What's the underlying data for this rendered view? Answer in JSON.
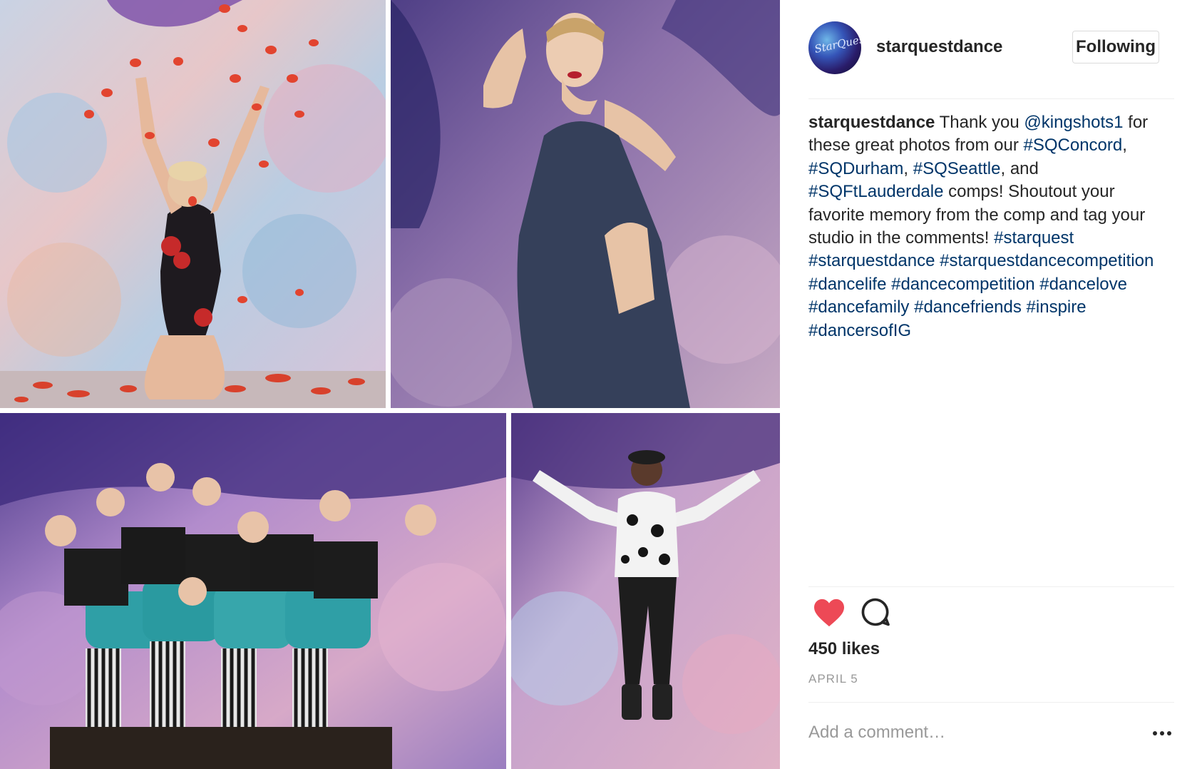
{
  "post": {
    "username": "starquestdance",
    "avatar_text": "StarQuest",
    "follow_label": "Following",
    "caption": {
      "username": "starquestdance",
      "text_thank": " Thank you ",
      "mention": "@kingshots1",
      "text_for": " for these great photos from our ",
      "tag_concord": "#SQConcord",
      "sep1": ", ",
      "tag_durham": "#SQDurham",
      "sep2": ", ",
      "tag_seattle": "#SQSeattle",
      "sep3": ", and ",
      "tag_ftl": "#SQFtLauderdale",
      "text_rest": " comps! Shoutout your favorite memory from the comp and tag your studio in the comments! ",
      "hashtags": [
        "#starquest",
        "#starquestdance",
        "#starquestdancecompetition",
        "#dancelife",
        "#dancecompetition",
        "#dancelove",
        "#dancefamily",
        "#dancefriends",
        "#inspire",
        "#dancersofIG"
      ]
    },
    "likes": "450 likes",
    "date": "APRIL 5",
    "comment_placeholder": "Add a comment…",
    "liked": true,
    "colors": {
      "heart": "#ed4956",
      "link": "#003569",
      "muted": "#999999",
      "text": "#262626",
      "border": "#dbdbdb"
    },
    "icons": [
      "heart-icon",
      "comment-icon",
      "more-options-icon"
    ]
  },
  "photos": [
    {
      "id": "photo-rose-petals"
    },
    {
      "id": "photo-dancer-navy"
    },
    {
      "id": "photo-group-dancers"
    },
    {
      "id": "photo-jumping-dancer"
    }
  ]
}
